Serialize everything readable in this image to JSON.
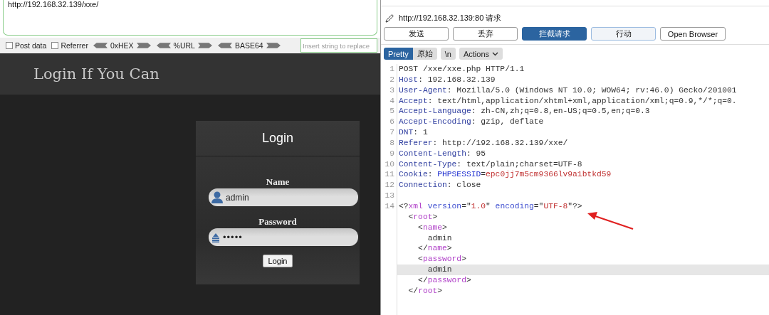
{
  "hackbar": {
    "url": "http://192.168.32.139/xxe/",
    "options": [
      {
        "label": "Post data",
        "checked": false
      },
      {
        "label": "Referrer",
        "checked": false
      }
    ],
    "encoders": [
      "0xHEX",
      "%URL",
      "BASE64"
    ],
    "replace_field": {
      "placeholder": "Insert string to replace"
    }
  },
  "site": {
    "title": "Login If You Can",
    "login_card": {
      "heading": "Login",
      "fields": [
        {
          "label": "Name",
          "kind": "user",
          "value": "admin"
        },
        {
          "label": "Password",
          "kind": "password",
          "value": "•••••"
        }
      ],
      "button": "Login"
    }
  },
  "proxy": {
    "request_title": "http://192.168.32.139:80 请求",
    "buttons": [
      {
        "label": "发送",
        "kind": "default"
      },
      {
        "label": "丢弃",
        "kind": "default"
      },
      {
        "label": "拦截请求",
        "kind": "primary"
      },
      {
        "label": "行动",
        "kind": "focused"
      },
      {
        "label": "Open Browser",
        "kind": "default"
      }
    ],
    "view_tabs": [
      {
        "label": "Pretty",
        "selected": true
      },
      {
        "label": "原始",
        "selected": false
      }
    ],
    "newline_toggle": {
      "label": "\\n",
      "on": false
    },
    "actions_menu": {
      "label": "Actions"
    },
    "lines": [
      {
        "number": "1",
        "highlighted": false,
        "tokens": [
          {
            "kind": "plain",
            "text": "POST /xxe/xxe.php HTTP/1.1"
          }
        ]
      },
      {
        "number": "2",
        "highlighted": false,
        "tokens": [
          {
            "kind": "key",
            "text": "Host"
          },
          {
            "kind": "plain",
            "text": ": 192.168.32.139"
          }
        ]
      },
      {
        "number": "3",
        "highlighted": false,
        "tokens": [
          {
            "kind": "key",
            "text": "User-Agent"
          },
          {
            "kind": "plain",
            "text": ": Mozilla/5.0 (Windows NT 10.0; WOW64; rv:46.0) Gecko/201001"
          }
        ]
      },
      {
        "number": "4",
        "highlighted": false,
        "tokens": [
          {
            "kind": "key",
            "text": "Accept"
          },
          {
            "kind": "plain",
            "text": ": text/html,application/xhtml+xml,application/xml;q=0.9,*/*;q=0."
          }
        ]
      },
      {
        "number": "5",
        "highlighted": false,
        "tokens": [
          {
            "kind": "key",
            "text": "Accept-Language"
          },
          {
            "kind": "plain",
            "text": ": zh-CN,zh;q=0.8,en-US;q=0.5,en;q=0.3"
          }
        ]
      },
      {
        "number": "6",
        "highlighted": false,
        "tokens": [
          {
            "kind": "key",
            "text": "Accept-Encoding"
          },
          {
            "kind": "plain",
            "text": ": gzip, deflate"
          }
        ]
      },
      {
        "number": "7",
        "highlighted": false,
        "tokens": [
          {
            "kind": "key",
            "text": "DNT"
          },
          {
            "kind": "plain",
            "text": ": 1"
          }
        ]
      },
      {
        "number": "8",
        "highlighted": false,
        "tokens": [
          {
            "kind": "key",
            "text": "Referer"
          },
          {
            "kind": "plain",
            "text": ": http://192.168.32.139/xxe/"
          }
        ]
      },
      {
        "number": "9",
        "highlighted": false,
        "tokens": [
          {
            "kind": "key",
            "text": "Content-Length"
          },
          {
            "kind": "plain",
            "text": ": 95"
          }
        ]
      },
      {
        "number": "10",
        "highlighted": false,
        "tokens": [
          {
            "kind": "key",
            "text": "Content-Type"
          },
          {
            "kind": "plain",
            "text": ": text/plain;charset=UTF-8"
          }
        ]
      },
      {
        "number": "11",
        "highlighted": false,
        "tokens": [
          {
            "kind": "key",
            "text": "Cookie"
          },
          {
            "kind": "plain",
            "text": ": "
          },
          {
            "kind": "cookie-name",
            "text": "PHPSESSID"
          },
          {
            "kind": "plain",
            "text": "="
          },
          {
            "kind": "value",
            "text": "epc0jj7m5cm9366lv9a1btkd59"
          }
        ]
      },
      {
        "number": "12",
        "highlighted": false,
        "tokens": [
          {
            "kind": "key",
            "text": "Connection"
          },
          {
            "kind": "plain",
            "text": ": close"
          }
        ]
      },
      {
        "number": "13",
        "highlighted": false
      },
      {
        "number": "14",
        "highlighted": false,
        "tokens": [
          {
            "kind": "plain",
            "text": "<?"
          },
          {
            "kind": "tag",
            "text": "xml"
          },
          {
            "kind": "attr",
            "text": " version"
          },
          {
            "kind": "plain",
            "text": "=\""
          },
          {
            "kind": "value",
            "text": "1.0"
          },
          {
            "kind": "plain",
            "text": "\" "
          },
          {
            "kind": "attr",
            "text": "encoding"
          },
          {
            "kind": "plain",
            "text": "=\""
          },
          {
            "kind": "value",
            "text": "UTF-8"
          },
          {
            "kind": "plain",
            "text": "\"?>"
          }
        ]
      },
      {
        "highlighted": false,
        "tokens": [
          {
            "kind": "plain",
            "text": "  <"
          },
          {
            "kind": "tag",
            "text": "root"
          },
          {
            "kind": "plain",
            "text": ">"
          }
        ]
      },
      {
        "highlighted": false,
        "tokens": [
          {
            "kind": "plain",
            "text": "    <"
          },
          {
            "kind": "tag",
            "text": "name"
          },
          {
            "kind": "plain",
            "text": ">"
          }
        ]
      },
      {
        "highlighted": false,
        "tokens": [
          {
            "kind": "plain",
            "text": "      admin"
          }
        ]
      },
      {
        "highlighted": false,
        "tokens": [
          {
            "kind": "plain",
            "text": "    </"
          },
          {
            "kind": "tag",
            "text": "name"
          },
          {
            "kind": "plain",
            "text": ">"
          }
        ]
      },
      {
        "highlighted": false,
        "tokens": [
          {
            "kind": "plain",
            "text": "    <"
          },
          {
            "kind": "tag",
            "text": "password"
          },
          {
            "kind": "plain",
            "text": ">"
          }
        ]
      },
      {
        "highlighted": true,
        "tokens": [
          {
            "kind": "plain",
            "text": "      admin"
          }
        ]
      },
      {
        "highlighted": false,
        "tokens": [
          {
            "kind": "plain",
            "text": "    </"
          },
          {
            "kind": "tag",
            "text": "password"
          },
          {
            "kind": "plain",
            "text": ">"
          }
        ]
      },
      {
        "highlighted": false,
        "tokens": [
          {
            "kind": "plain",
            "text": "  </"
          },
          {
            "kind": "tag",
            "text": "root"
          },
          {
            "kind": "plain",
            "text": ">"
          }
        ]
      }
    ]
  }
}
